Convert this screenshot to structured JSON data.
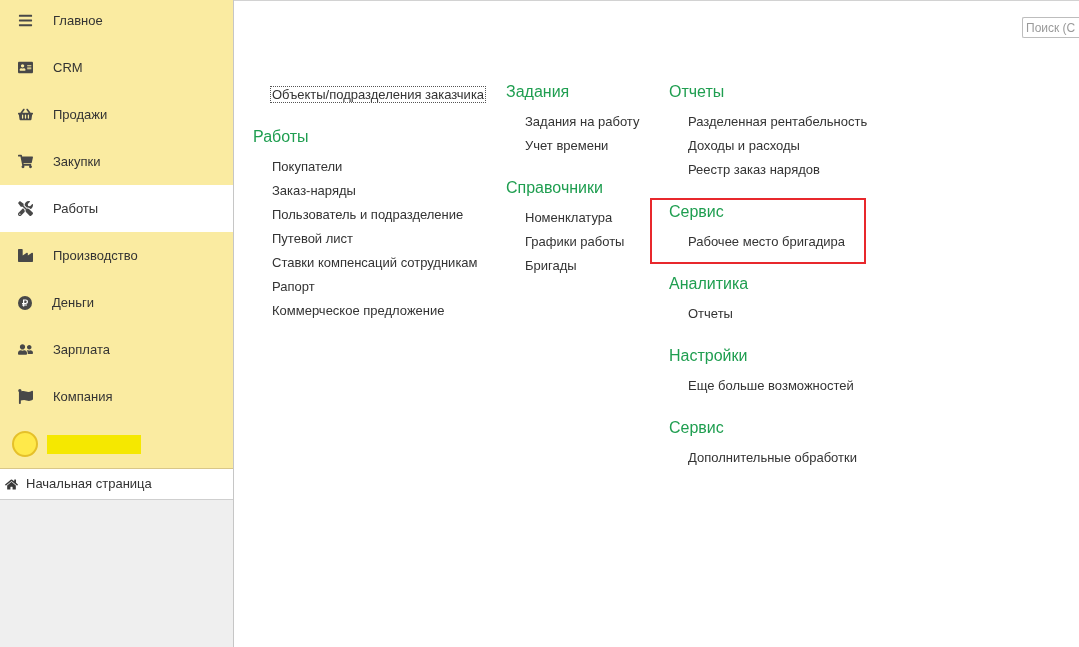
{
  "sidebar": {
    "items": [
      {
        "label": "Главное",
        "selected": false
      },
      {
        "label": "CRM",
        "selected": false
      },
      {
        "label": "Продажи",
        "selected": false
      },
      {
        "label": "Закупки",
        "selected": false
      },
      {
        "label": "Работы",
        "selected": true
      },
      {
        "label": "Производство",
        "selected": false
      },
      {
        "label": "Деньги",
        "selected": false
      },
      {
        "label": "Зарплата",
        "selected": false
      },
      {
        "label": "Компания",
        "selected": false
      }
    ],
    "home_link": {
      "label": "Начальная страница"
    }
  },
  "search": {
    "placeholder": "Поиск (C"
  },
  "columns": [
    {
      "sections": [
        {
          "highlighted": false,
          "items": [
            {
              "label": "Объекты/подразделения заказчика",
              "focused": true
            }
          ]
        },
        {
          "title": "Работы",
          "highlighted": false,
          "items": [
            {
              "label": "Покупатели",
              "focused": false
            },
            {
              "label": "Заказ-наряды",
              "focused": false
            },
            {
              "label": "Пользователь и подразделение",
              "focused": false
            },
            {
              "label": "Путевой лист",
              "focused": false
            },
            {
              "label": "Ставки компенсаций сотрудникам",
              "focused": false
            },
            {
              "label": "Рапорт",
              "focused": false
            },
            {
              "label": "Коммерческое предложение",
              "focused": false
            }
          ]
        }
      ]
    },
    {
      "sections": [
        {
          "title": "Задания",
          "highlighted": false,
          "items": [
            {
              "label": "Задания на работу",
              "focused": false
            },
            {
              "label": "Учет времени",
              "focused": false
            }
          ]
        },
        {
          "title": "Справочники",
          "highlighted": false,
          "items": [
            {
              "label": "Номенклатура",
              "focused": false
            },
            {
              "label": "Графики работы",
              "focused": false
            },
            {
              "label": "Бригады",
              "focused": false
            }
          ]
        }
      ]
    },
    {
      "sections": [
        {
          "title": "Отчеты",
          "highlighted": false,
          "items": [
            {
              "label": "Разделенная рентабельность",
              "focused": false
            },
            {
              "label": "Доходы и расходы",
              "focused": false
            },
            {
              "label": "Реестр заказ нарядов",
              "focused": false
            }
          ]
        },
        {
          "title": "Сервис",
          "highlighted": true,
          "items": [
            {
              "label": "Рабочее место бригадира",
              "focused": false
            }
          ]
        },
        {
          "title": "Аналитика",
          "highlighted": false,
          "items": [
            {
              "label": "Отчеты",
              "focused": false
            }
          ]
        },
        {
          "title": "Настройки",
          "highlighted": false,
          "items": [
            {
              "label": "Еще больше возможностей",
              "focused": false
            }
          ]
        },
        {
          "title": "Сервис",
          "highlighted": false,
          "items": [
            {
              "label": "Дополнительные обработки",
              "focused": false
            }
          ]
        }
      ]
    }
  ]
}
